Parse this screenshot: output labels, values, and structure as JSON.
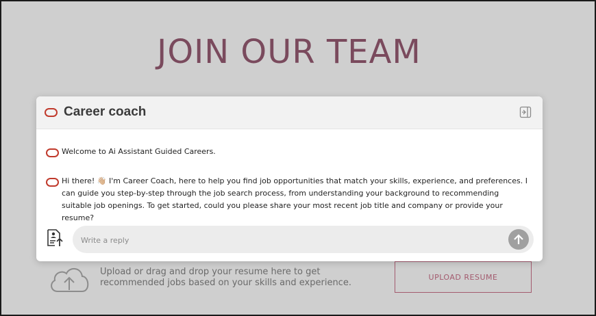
{
  "background": {
    "hero_title": "JOIN OUR TEAM",
    "upload_text": "Upload or drag and drop your resume here to get recommended jobs based on your skills and experience.",
    "upload_button": "UPLOAD RESUME"
  },
  "modal": {
    "title": "Career coach",
    "messages": [
      {
        "text": "Welcome to Ai Assistant Guided Careers."
      },
      {
        "text": "Hi there! 👋🏼 I'm Career Coach, here to help you find job opportunities that match your skills, experience, and preferences. I can guide you step-by-step through the job search process, from understanding your background to recommending suitable job openings. To get started, could you please share your most recent job title and company or provide your resume?"
      }
    ],
    "reply_placeholder": "Write a reply"
  },
  "colors": {
    "brand": "#c0392b",
    "hero": "#7a4a5d",
    "upload_button": "#a35a6e",
    "send_button": "#a0a0a0"
  }
}
